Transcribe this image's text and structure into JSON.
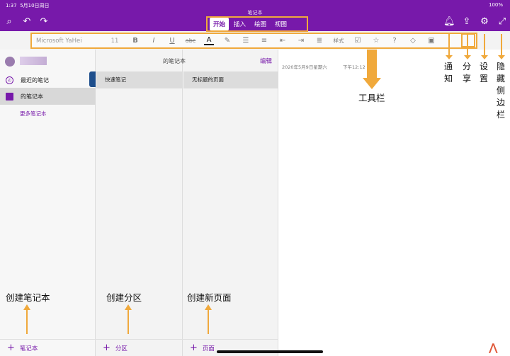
{
  "status": {
    "time": "1:37",
    "date": "5月10日周日",
    "battery": "100%"
  },
  "window": {
    "title": "笔记本"
  },
  "tabs": [
    {
      "label": "开始",
      "active": true
    },
    {
      "label": "插入",
      "active": false
    },
    {
      "label": "绘图",
      "active": false
    },
    {
      "label": "视图",
      "active": false
    }
  ],
  "toolbar": {
    "font_name": "Microsoft YaHei",
    "font_size": "11",
    "bold": "B",
    "italic": "I",
    "underline": "U",
    "strike": "abc",
    "font_color": "A",
    "style_label": "样式",
    "help": "?"
  },
  "sidebar": {
    "recent": "最近的笔记",
    "notebook": "的笔记本",
    "more": "更多笔记本",
    "add": "笔记本"
  },
  "header": {
    "notebook_title": "的笔记本",
    "edit": "编辑"
  },
  "sections": {
    "item": "快速笔记",
    "add": "分区"
  },
  "pages": {
    "item": "无标题的页面",
    "add": "页面"
  },
  "page": {
    "date": "2020年5月9日星期六",
    "time": "下午12:12"
  },
  "annotations": {
    "toolbar": "工具栏",
    "notify": "通知",
    "share": "分享",
    "settings": "设置",
    "hide_sidebar": "隐藏侧边栏",
    "create_notebook": "创建笔记本",
    "create_section": "创建分区",
    "create_page": "创建新页面"
  },
  "colors": {
    "brand": "#7719aa",
    "annotation": "#f0a93c"
  },
  "icons": [
    "search-icon",
    "undo-icon",
    "redo-icon",
    "bell-icon",
    "share-icon",
    "gear-icon",
    "expand-icon"
  ]
}
